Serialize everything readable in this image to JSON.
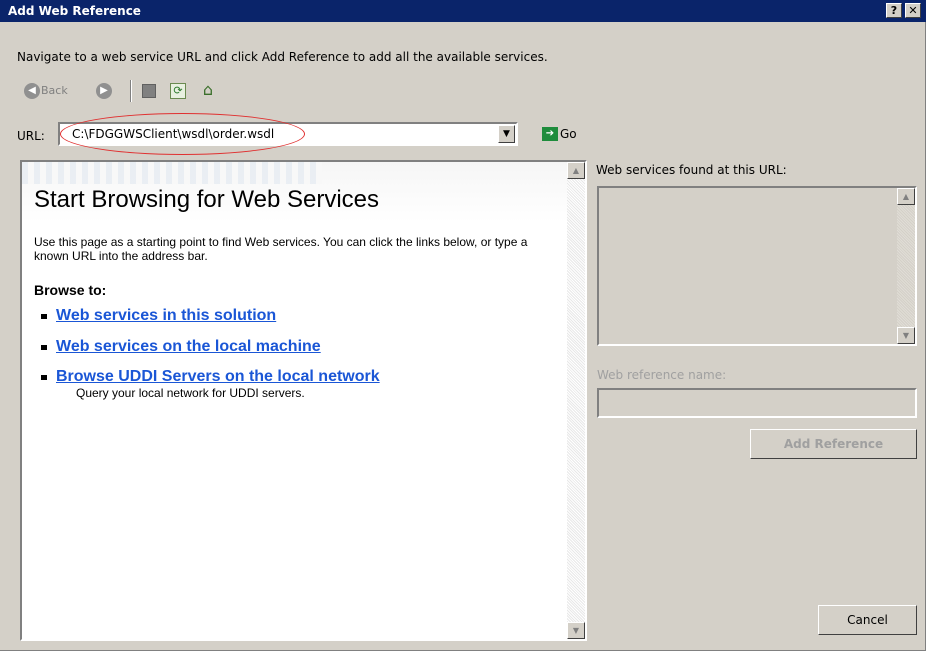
{
  "window": {
    "title": "Add Web Reference",
    "help_label": "?",
    "close_label": "✕"
  },
  "instruction": "Navigate to a web service URL and click Add Reference to add all the available services.",
  "nav": {
    "back_label": "Back"
  },
  "url_bar": {
    "label": "URL:",
    "value": "C:\\FDGGWSClient\\wsdl\\order.wsdl",
    "go_label": "Go"
  },
  "browser": {
    "heading": "Start Browsing for Web Services",
    "description": "Use this page as a starting point to find Web services. You can click the links below, or type a known URL into the address bar.",
    "browse_to": "Browse to:",
    "links": [
      {
        "label": "Web services in this solution"
      },
      {
        "label": "Web services on the local machine"
      },
      {
        "label": "Browse UDDI Servers on the local network",
        "sub": "Query your local network for UDDI servers."
      }
    ]
  },
  "right_panel": {
    "found_label": "Web services found at this URL:",
    "ref_name_label": "Web reference name:",
    "add_reference_label": "Add Reference",
    "cancel_label": "Cancel"
  },
  "colors": {
    "titlebar": "#0a246a",
    "dialog_bg": "#d4d0c8",
    "link": "#1a56d6",
    "highlight_ellipse": "#e03030"
  }
}
